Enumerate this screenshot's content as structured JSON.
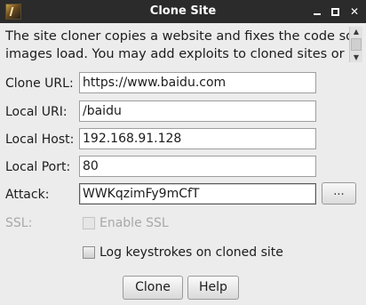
{
  "window": {
    "title": "Clone Site"
  },
  "description": {
    "line1": "The site cloner copies a website and fixes the code so",
    "line2": "images load. You may add exploits to cloned sites or"
  },
  "form": {
    "clone_url": {
      "label": "Clone URL:",
      "value": "https://www.baidu.com"
    },
    "local_uri": {
      "label": "Local URI:",
      "value": "/baidu"
    },
    "local_host": {
      "label": "Local Host:",
      "value": "192.168.91.128"
    },
    "local_port": {
      "label": "Local Port:",
      "value": "80"
    },
    "attack": {
      "label": "Attack:",
      "value": "WWKqzimFy9mCfT",
      "browse_label": "..."
    },
    "ssl": {
      "label": "SSL:",
      "checkbox_label": "Enable SSL",
      "checked": false,
      "enabled": false
    },
    "log_keystrokes": {
      "checkbox_label": "Log keystrokes on cloned site",
      "checked": false
    }
  },
  "buttons": {
    "clone": "Clone",
    "help": "Help"
  },
  "icons": {
    "app": "cobalt-strike-app-icon",
    "minimize": "minimize-icon",
    "maximize": "maximize-icon",
    "close": "close-icon",
    "scroll_up": "chevron-up-icon",
    "scroll_down": "chevron-down-icon"
  }
}
